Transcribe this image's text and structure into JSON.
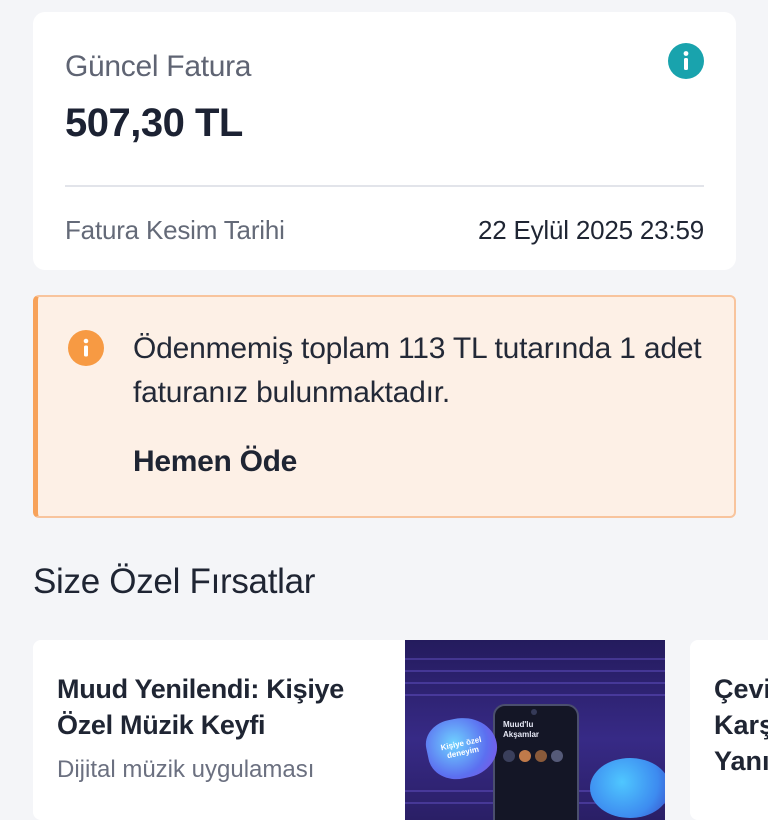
{
  "bill": {
    "title": "Güncel Fatura",
    "amount": "507,30 TL",
    "due_label": "Fatura Kesim Tarihi",
    "due_value": "22 Eylül 2025 23:59"
  },
  "alert": {
    "text": "Ödenmemiş toplam 113 TL tutarında 1 adet faturanız bulunmaktadır.",
    "action": "Hemen Öde"
  },
  "offers": {
    "section_title": "Size Özel Fırsatlar",
    "items": [
      {
        "title": "Muud Yenilendi: Kişiye Özel Müzik Keyfi",
        "description": "Dijital müzik uygulaması",
        "image_blob_label": "Kişiye özel deneyim",
        "image_phone_text": "Muud'lu Akşamlar"
      },
      {
        "title": "Çevi\nKarş\nYanı"
      }
    ]
  },
  "colors": {
    "info_icon": "#19a3ad",
    "alert_icon": "#f79a43",
    "alert_bg": "#fdf0e6",
    "alert_border": "#f7a25a"
  },
  "icons": {
    "bill_info": "info-icon",
    "alert": "info-icon"
  }
}
